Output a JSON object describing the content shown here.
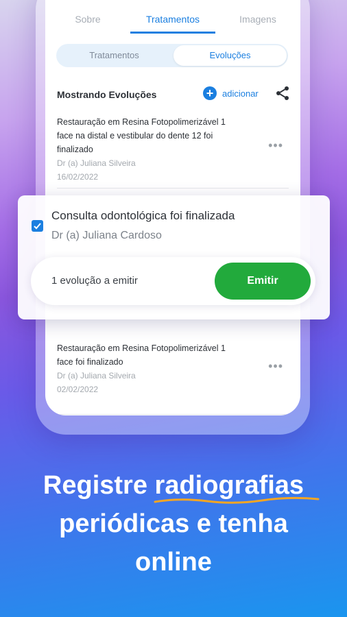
{
  "tabs": [
    {
      "label": "Sobre"
    },
    {
      "label": "Tratamentos"
    },
    {
      "label": "Imagens"
    }
  ],
  "segmented": [
    {
      "label": "Tratamentos"
    },
    {
      "label": "Evoluções"
    }
  ],
  "section": {
    "title": "Mostrando Evoluções",
    "add_label": "adicionar",
    "add_icon": "plus-circle-icon",
    "share_icon": "share-icon"
  },
  "items": [
    {
      "title": "Restauração em Resina Fotopolimerizável 1 face na distal e vestibular do dente 12 foi finalizado",
      "doctor": "Dr (a) Juliana Silveira",
      "date": "16/02/2022",
      "more": "•••"
    },
    {
      "title": "Restauração em Resina Fotopolimerizável 1 face foi finalizado",
      "doctor": "Dr (a) Juliana Silveira",
      "date": "02/02/2022",
      "more": "•••"
    }
  ],
  "card": {
    "title": "Consulta odontológica foi finalizada",
    "doctor": "Dr (a) Juliana Cardoso",
    "pending": "1 evolução a emitir",
    "emit_label": "Emitir",
    "checked": true
  },
  "headline": {
    "part1": "Registre ",
    "highlight": "radiografias",
    "line2": "periódicas e tenha",
    "line3": "online"
  },
  "colors": {
    "accent": "#1b7fe0",
    "emit": "#22aa3c",
    "underline": "#f5a623"
  }
}
